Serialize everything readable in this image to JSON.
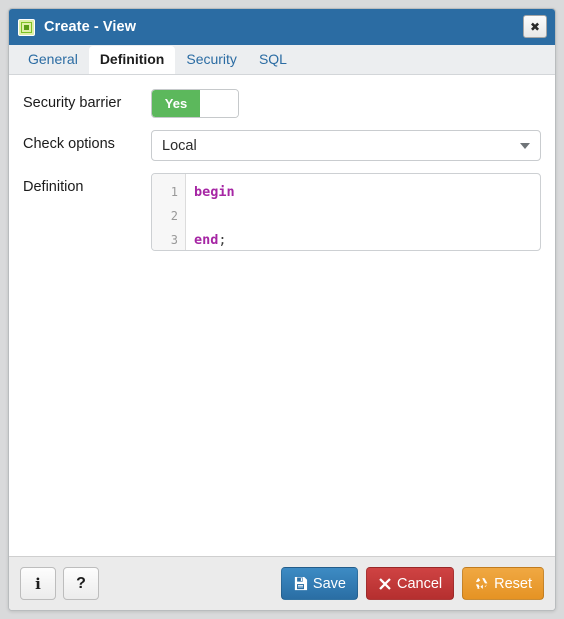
{
  "window": {
    "title": "Create - View",
    "icon": "view-icon",
    "close_label": "✖"
  },
  "tabs": [
    {
      "label": "General",
      "active": false
    },
    {
      "label": "Definition",
      "active": true
    },
    {
      "label": "Security",
      "active": false
    },
    {
      "label": "SQL",
      "active": false
    }
  ],
  "form": {
    "security_barrier": {
      "label": "Security barrier",
      "value": "Yes",
      "state": "on"
    },
    "check_options": {
      "label": "Check options",
      "value": "Local"
    },
    "definition": {
      "label": "Definition",
      "lines": [
        {
          "number": "1",
          "keyword": "begin",
          "punct": ""
        },
        {
          "number": "2",
          "keyword": "",
          "punct": ""
        },
        {
          "number": "3",
          "keyword": "end",
          "punct": ";"
        }
      ]
    }
  },
  "footer": {
    "info_label": "i",
    "help_label": "?",
    "save_label": "Save",
    "cancel_label": "Cancel",
    "reset_label": "Reset"
  },
  "colors": {
    "titlebar": "#2b6ca3",
    "accent_link": "#2b6ca3",
    "toggle_on": "#5cb85c",
    "keyword": "#a626a4",
    "save": "#2a6ea4",
    "cancel": "#b52f2f",
    "reset": "#e59324"
  }
}
